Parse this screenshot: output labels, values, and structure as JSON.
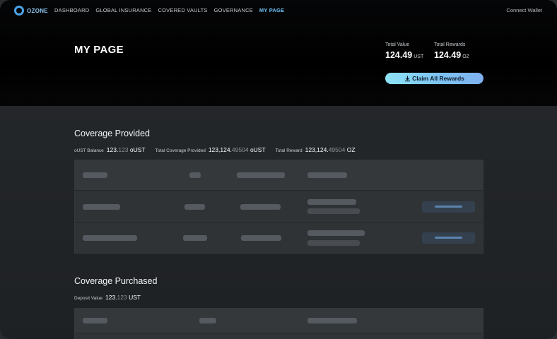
{
  "nav": {
    "logo_text": "OZONE",
    "links": [
      "DASHBOARD",
      "GLOBAL INSURANCE",
      "COVERED VAULTS",
      "GOVERNANCE",
      "MY PAGE"
    ],
    "active_index": 4,
    "connect_wallet": "Connect Wallet"
  },
  "hero": {
    "title": "MY PAGE",
    "total_value": {
      "label": "Total Value",
      "value": "124.49",
      "unit": "UST"
    },
    "total_rewards": {
      "label": "Total Rewards",
      "value": "124.49",
      "unit": "OZ"
    },
    "claim_button": "Claim All Rewards"
  },
  "coverage_provided": {
    "title": "Coverage Provided",
    "oust_balance": {
      "label": "oUST Balance",
      "int": "123.",
      "dec": "123",
      "unit": "oUST"
    },
    "total_coverage": {
      "label": "Total Coverage Provided",
      "int": "123,124.",
      "dec": "49504",
      "unit": "oUST"
    },
    "total_reward": {
      "label": "Total Reward",
      "int": "123,124.",
      "dec": "49504",
      "unit": "OZ"
    }
  },
  "coverage_purchased": {
    "title": "Coverage Purchased",
    "deposit_value": {
      "label": "Deposit Value",
      "int": "123.",
      "dec": "123",
      "unit": "UST"
    }
  },
  "colors": {
    "accent": "#6ec2f7",
    "button_gradient_start": "#8ee3f5",
    "button_gradient_end": "#7fb0ef"
  }
}
